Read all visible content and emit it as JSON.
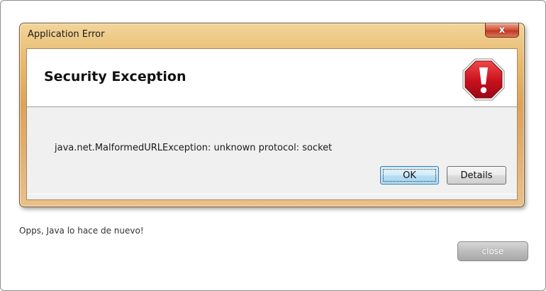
{
  "dialog": {
    "title": "Application Error",
    "close_glyph": "x",
    "heading": "Security Exception",
    "icon": "stop-exclamation-icon",
    "message": "java.net.MalformedURLException: unknown protocol: socket",
    "buttons": {
      "ok_label": "OK",
      "details_label": "Details"
    }
  },
  "page": {
    "caption": "Opps, Java lo hace de nuevo!",
    "close_label": "close"
  },
  "colors": {
    "stop_icon_red": "#c8101e",
    "window_frame": "#dca35a",
    "close_button": "#b5b5b5"
  }
}
